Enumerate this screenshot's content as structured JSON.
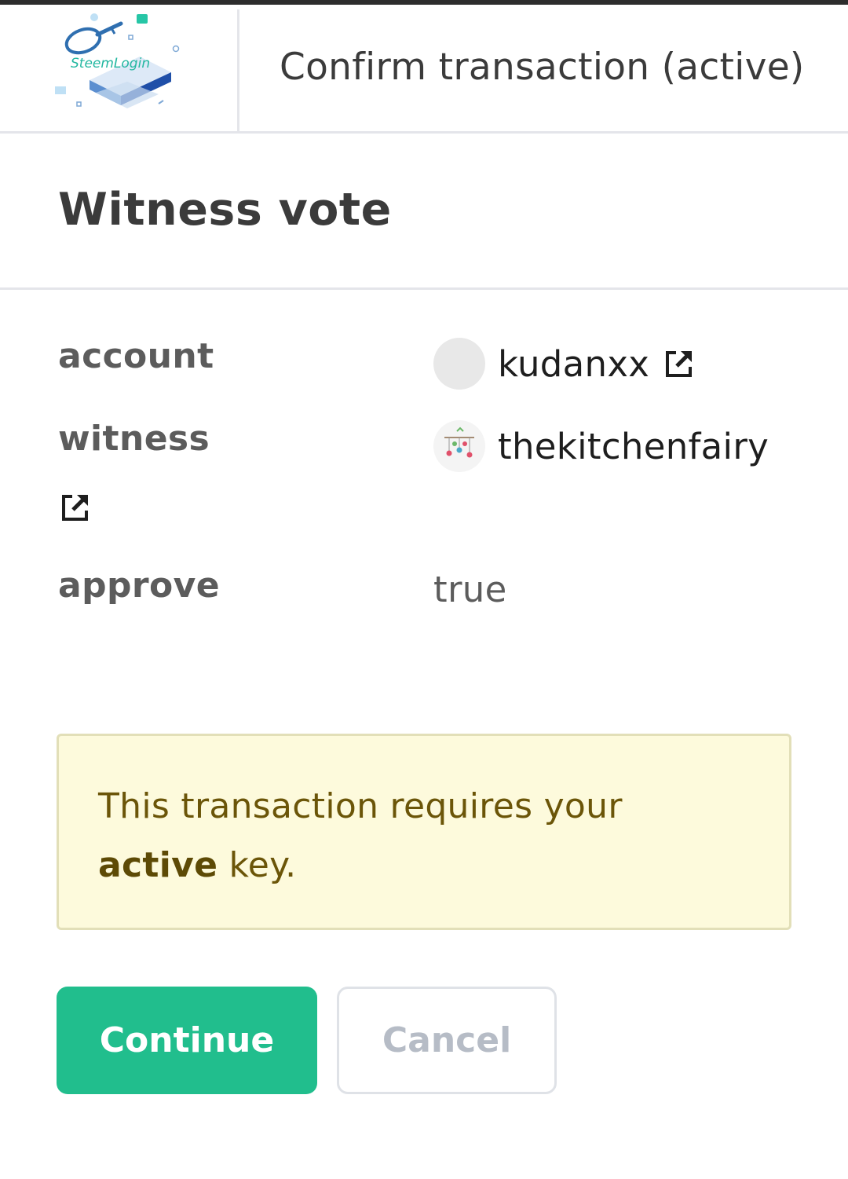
{
  "app": {
    "logo_text": "SteemLogin",
    "title": "Confirm transaction (active)"
  },
  "operation": {
    "title": "Witness vote",
    "fields": [
      {
        "key": "account",
        "value": "kudanxx",
        "external_link_icon": "external-link-icon"
      },
      {
        "key": "witness",
        "value": "thekitchenfairy",
        "external_link_icon": "external-link-icon"
      },
      {
        "key": "approve",
        "value": "true"
      }
    ]
  },
  "notice": {
    "text_before": "This transaction requires your ",
    "emphasis": "active",
    "text_after": " key."
  },
  "actions": {
    "continue_label": "Continue",
    "cancel_label": "Cancel"
  },
  "colors": {
    "accent": "#21be8d",
    "notice_bg": "#fdfadc",
    "notice_text": "#6b5508"
  }
}
